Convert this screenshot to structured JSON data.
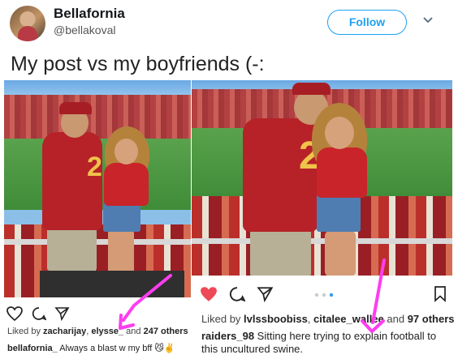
{
  "user": {
    "display_name": "Bellafornia",
    "handle": "@bellakoval"
  },
  "follow_label": "Follow",
  "tweet_text": "My post vs my boyfriends (-:",
  "left_photo": {
    "jersey_number": "2",
    "liked_prefix": "Liked by ",
    "liked_user": "zacharijay",
    "liked_sep": ", ",
    "liked_user2": "elysse_",
    "liked_suffix": " and ",
    "liked_count": "247 others",
    "caption_user": "bellafornia_",
    "caption_text": " Always a blast w my bff 😼✌️"
  },
  "right_photo": {
    "jersey_number": "2",
    "liked_prefix": "Liked by ",
    "liked_user": "lvlssboobiss",
    "liked_sep": ", ",
    "liked_user2": "citalee_wallee",
    "liked_suffix": " and ",
    "liked_count": "97 others",
    "caption_user": "raiders_98",
    "caption_text": " Sitting here trying to explain football to this uncultured swine."
  },
  "colors": {
    "twitter_blue": "#1da1f2",
    "heart_red": "#ed4956",
    "arrow_magenta": "#ff3df0"
  }
}
